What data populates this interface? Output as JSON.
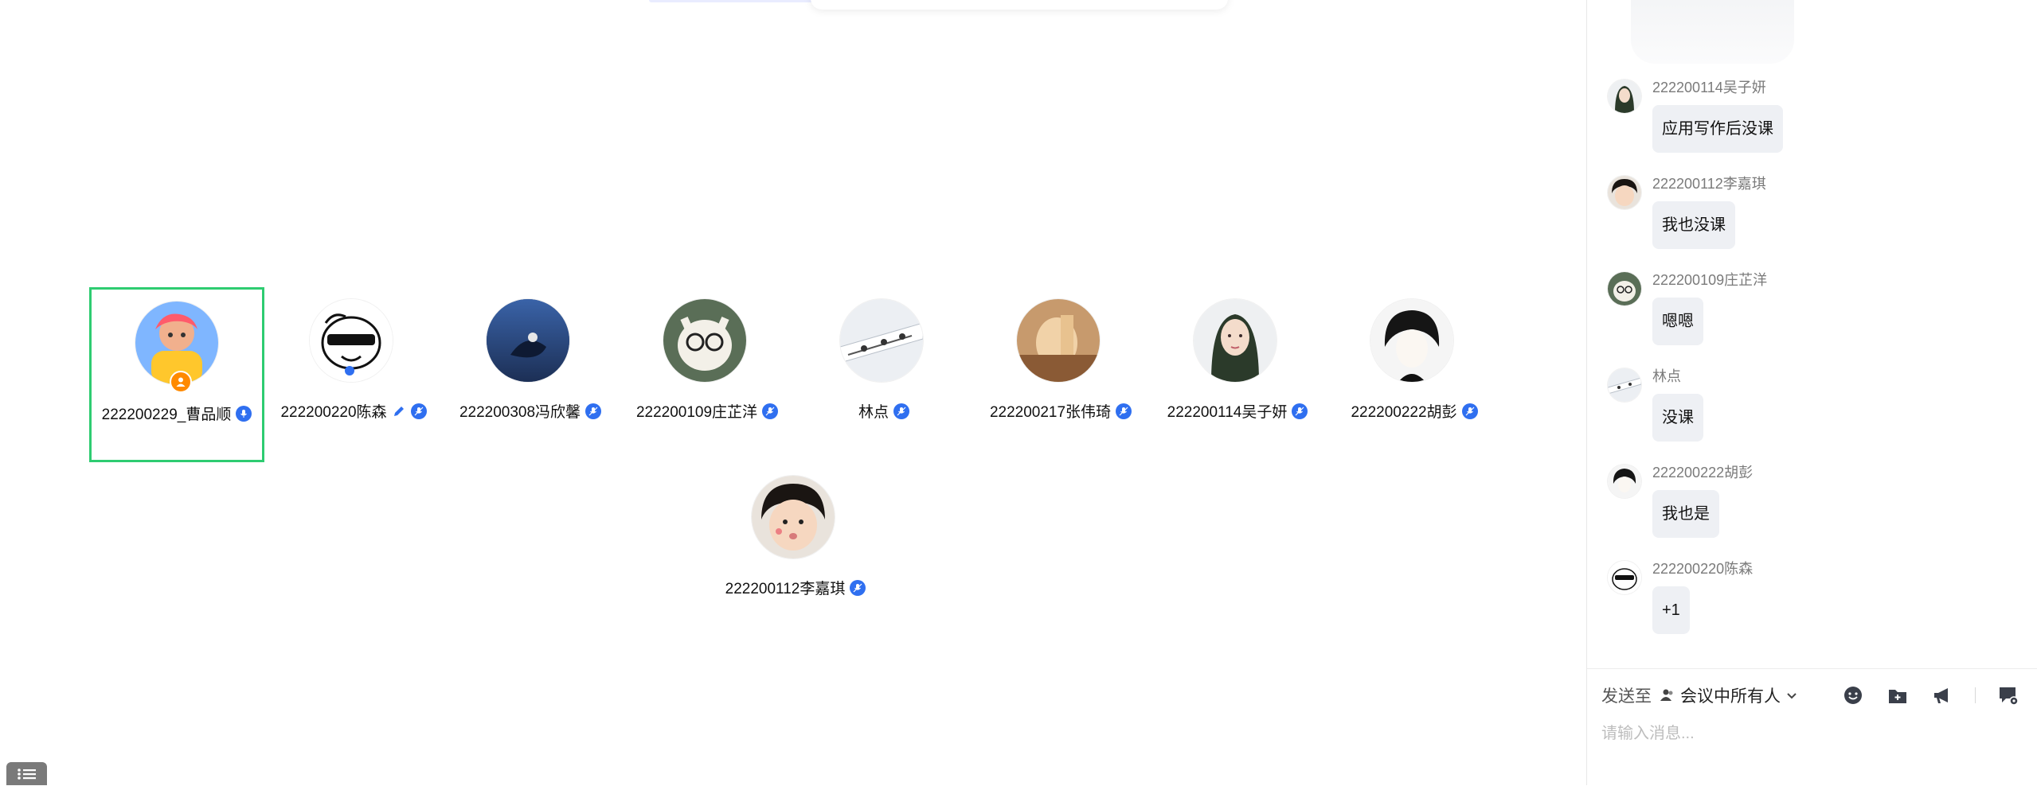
{
  "participants": [
    {
      "name": "222200229_曹品顺",
      "is_host": true,
      "active": true,
      "editing": false
    },
    {
      "name": "222200220陈森",
      "is_host": false,
      "active": false,
      "editing": true
    },
    {
      "name": "222200308冯欣馨",
      "is_host": false,
      "active": false,
      "editing": false
    },
    {
      "name": "222200109庄芷洋",
      "is_host": false,
      "active": false,
      "editing": false
    },
    {
      "name": "林点",
      "is_host": false,
      "active": false,
      "editing": false
    },
    {
      "name": "222200217张伟琦",
      "is_host": false,
      "active": false,
      "editing": false
    },
    {
      "name": "222200114吴子妍",
      "is_host": false,
      "active": false,
      "editing": false
    },
    {
      "name": "222200222胡彭",
      "is_host": false,
      "active": false,
      "editing": false
    },
    {
      "name": "222200112李嘉琪",
      "is_host": false,
      "active": false,
      "editing": false
    }
  ],
  "chat": {
    "messages": [
      {
        "sender": "222200114吴子妍",
        "text": "应用写作后没课"
      },
      {
        "sender": "222200112李嘉琪",
        "text": "我也没课"
      },
      {
        "sender": "222200109庄芷洋",
        "text": "嗯嗯"
      },
      {
        "sender": "林点",
        "text": "没课"
      },
      {
        "sender": "222200222胡彭",
        "text": "我也是"
      },
      {
        "sender": "222200220陈森",
        "text": "+1"
      }
    ],
    "send_to_label": "发送至",
    "send_to_target": "会议中所有人",
    "input_placeholder": "请输入消息..."
  },
  "colors": {
    "active_border": "#2ecc71",
    "mic_blue": "#2f6ff0",
    "host_orange": "#ff8a00",
    "bubble_bg": "#eef0f4"
  }
}
